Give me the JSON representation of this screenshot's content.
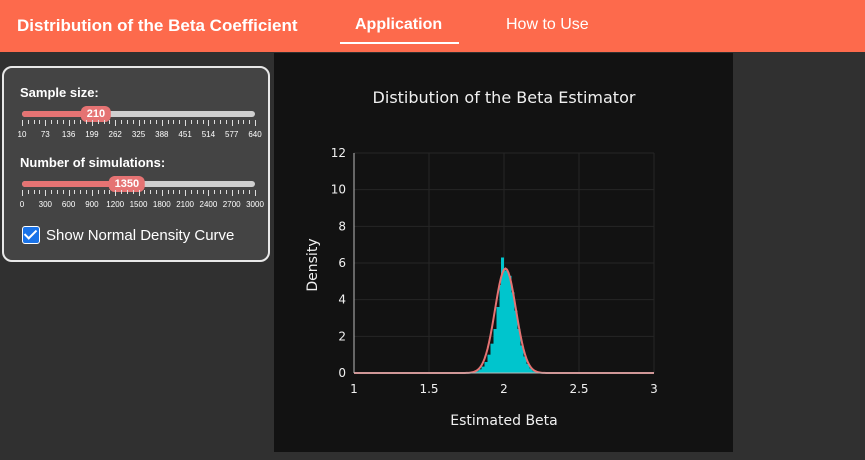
{
  "navbar": {
    "brand": "Distribution of the Beta Coefficient",
    "tabs": [
      {
        "label": "Application",
        "active": true
      },
      {
        "label": "How to Use",
        "active": false
      }
    ],
    "background_color": "#fd6a4c"
  },
  "sidebar": {
    "sample_size": {
      "label": "Sample size:",
      "value": "210",
      "min": 10,
      "max": 640,
      "ticks": [
        "10",
        "73",
        "136",
        "199",
        "262",
        "325",
        "388",
        "451",
        "514",
        "577",
        "640"
      ]
    },
    "simulations": {
      "label": "Number of simulations:",
      "value": "1350",
      "min": 0,
      "max": 3000,
      "ticks": [
        "0",
        "300",
        "600",
        "900",
        "1200",
        "1500",
        "1800",
        "2100",
        "2400",
        "2700",
        "3000"
      ]
    },
    "normal_curve": {
      "label": "Show Normal Density Curve",
      "checked": true
    },
    "slider_color": "#e57373"
  },
  "chart_data": {
    "type": "bar",
    "title": "Distibution of the Beta Estimator",
    "xlabel": "Estimated Beta",
    "ylabel": "Density",
    "xlim": [
      1,
      3
    ],
    "ylim": [
      0,
      12
    ],
    "x_ticks": [
      "1",
      "1.5",
      "2",
      "2.5",
      "3"
    ],
    "y_ticks": [
      "0",
      "2",
      "4",
      "6",
      "8",
      "10",
      "12"
    ],
    "grid": true,
    "histogram_color": "#00c5cd",
    "curve_color": "#e57373",
    "bins": [
      {
        "x": 1.8,
        "density": 0.05
      },
      {
        "x": 1.82,
        "density": 0.1
      },
      {
        "x": 1.84,
        "density": 0.2
      },
      {
        "x": 1.86,
        "density": 0.35
      },
      {
        "x": 1.88,
        "density": 0.6
      },
      {
        "x": 1.9,
        "density": 1.0
      },
      {
        "x": 1.92,
        "density": 1.6
      },
      {
        "x": 1.94,
        "density": 2.4
      },
      {
        "x": 1.96,
        "density": 3.6
      },
      {
        "x": 1.98,
        "density": 4.8
      },
      {
        "x": 1.99,
        "density": 6.3
      },
      {
        "x": 2.0,
        "density": 5.6
      },
      {
        "x": 2.02,
        "density": 5.6
      },
      {
        "x": 2.04,
        "density": 5.3
      },
      {
        "x": 2.06,
        "density": 4.4
      },
      {
        "x": 2.08,
        "density": 3.4
      },
      {
        "x": 2.1,
        "density": 2.4
      },
      {
        "x": 2.12,
        "density": 1.5
      },
      {
        "x": 2.14,
        "density": 0.9
      },
      {
        "x": 2.16,
        "density": 0.5
      },
      {
        "x": 2.18,
        "density": 0.25
      },
      {
        "x": 2.2,
        "density": 0.1
      },
      {
        "x": 2.22,
        "density": 0.05
      }
    ],
    "normal_curve": {
      "mean": 2.01,
      "sd": 0.07
    }
  }
}
